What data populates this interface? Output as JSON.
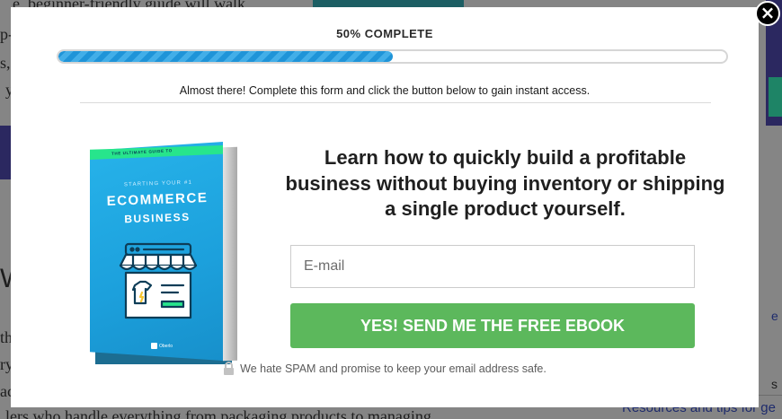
{
  "background_page": {
    "lines": [
      "e, beginner-friendly guide will walk",
      "p-",
      "s,",
      "y",
      "W",
      "th",
      "ry",
      "ac",
      "lers who handle everything from packaging products to managing"
    ],
    "right_text": [
      "Resources and tips for ge",
      "s",
      "e"
    ]
  },
  "modal": {
    "progress": {
      "label": "50% COMPLETE",
      "percent": 50,
      "bar_color": "#1f94d8"
    },
    "instruction": "Almost there! Complete this form and click the button below to gain instant access.",
    "ebook": {
      "small_title": "THE ULTIMATE GUIDE TO",
      "kicker": "STARTING YOUR #1",
      "title_line1": "ECOMMERCE",
      "title_line2": "BUSINESS",
      "brand": "Oberlo"
    },
    "headline": "Learn how to quickly build a profitable business without buying inventory or shipping a single product yourself.",
    "email": {
      "placeholder": "E-mail",
      "value": ""
    },
    "cta_label": "YES! SEND ME THE FREE EBOOK",
    "cta_color": "#5cb85c",
    "spam_note": "We hate SPAM and promise to keep your email address safe.",
    "close_label": "×"
  }
}
